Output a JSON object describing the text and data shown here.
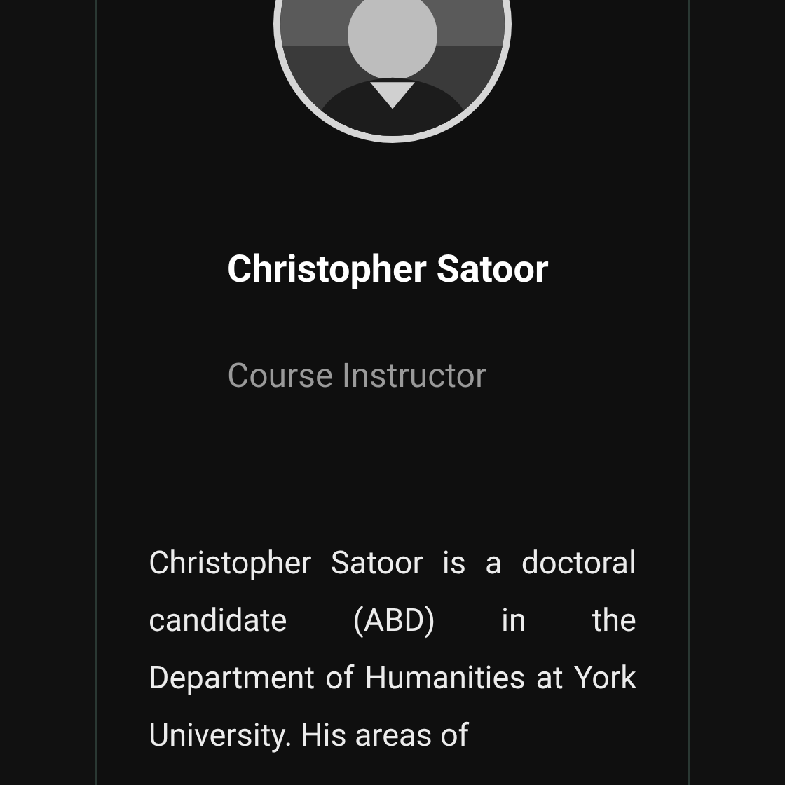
{
  "profile": {
    "name": "Christopher Satoor",
    "role": "Course Instructor",
    "bio": "Christopher Satoor is a doctoral candidate (ABD) in the Department of Humanities at York University. His areas of"
  }
}
